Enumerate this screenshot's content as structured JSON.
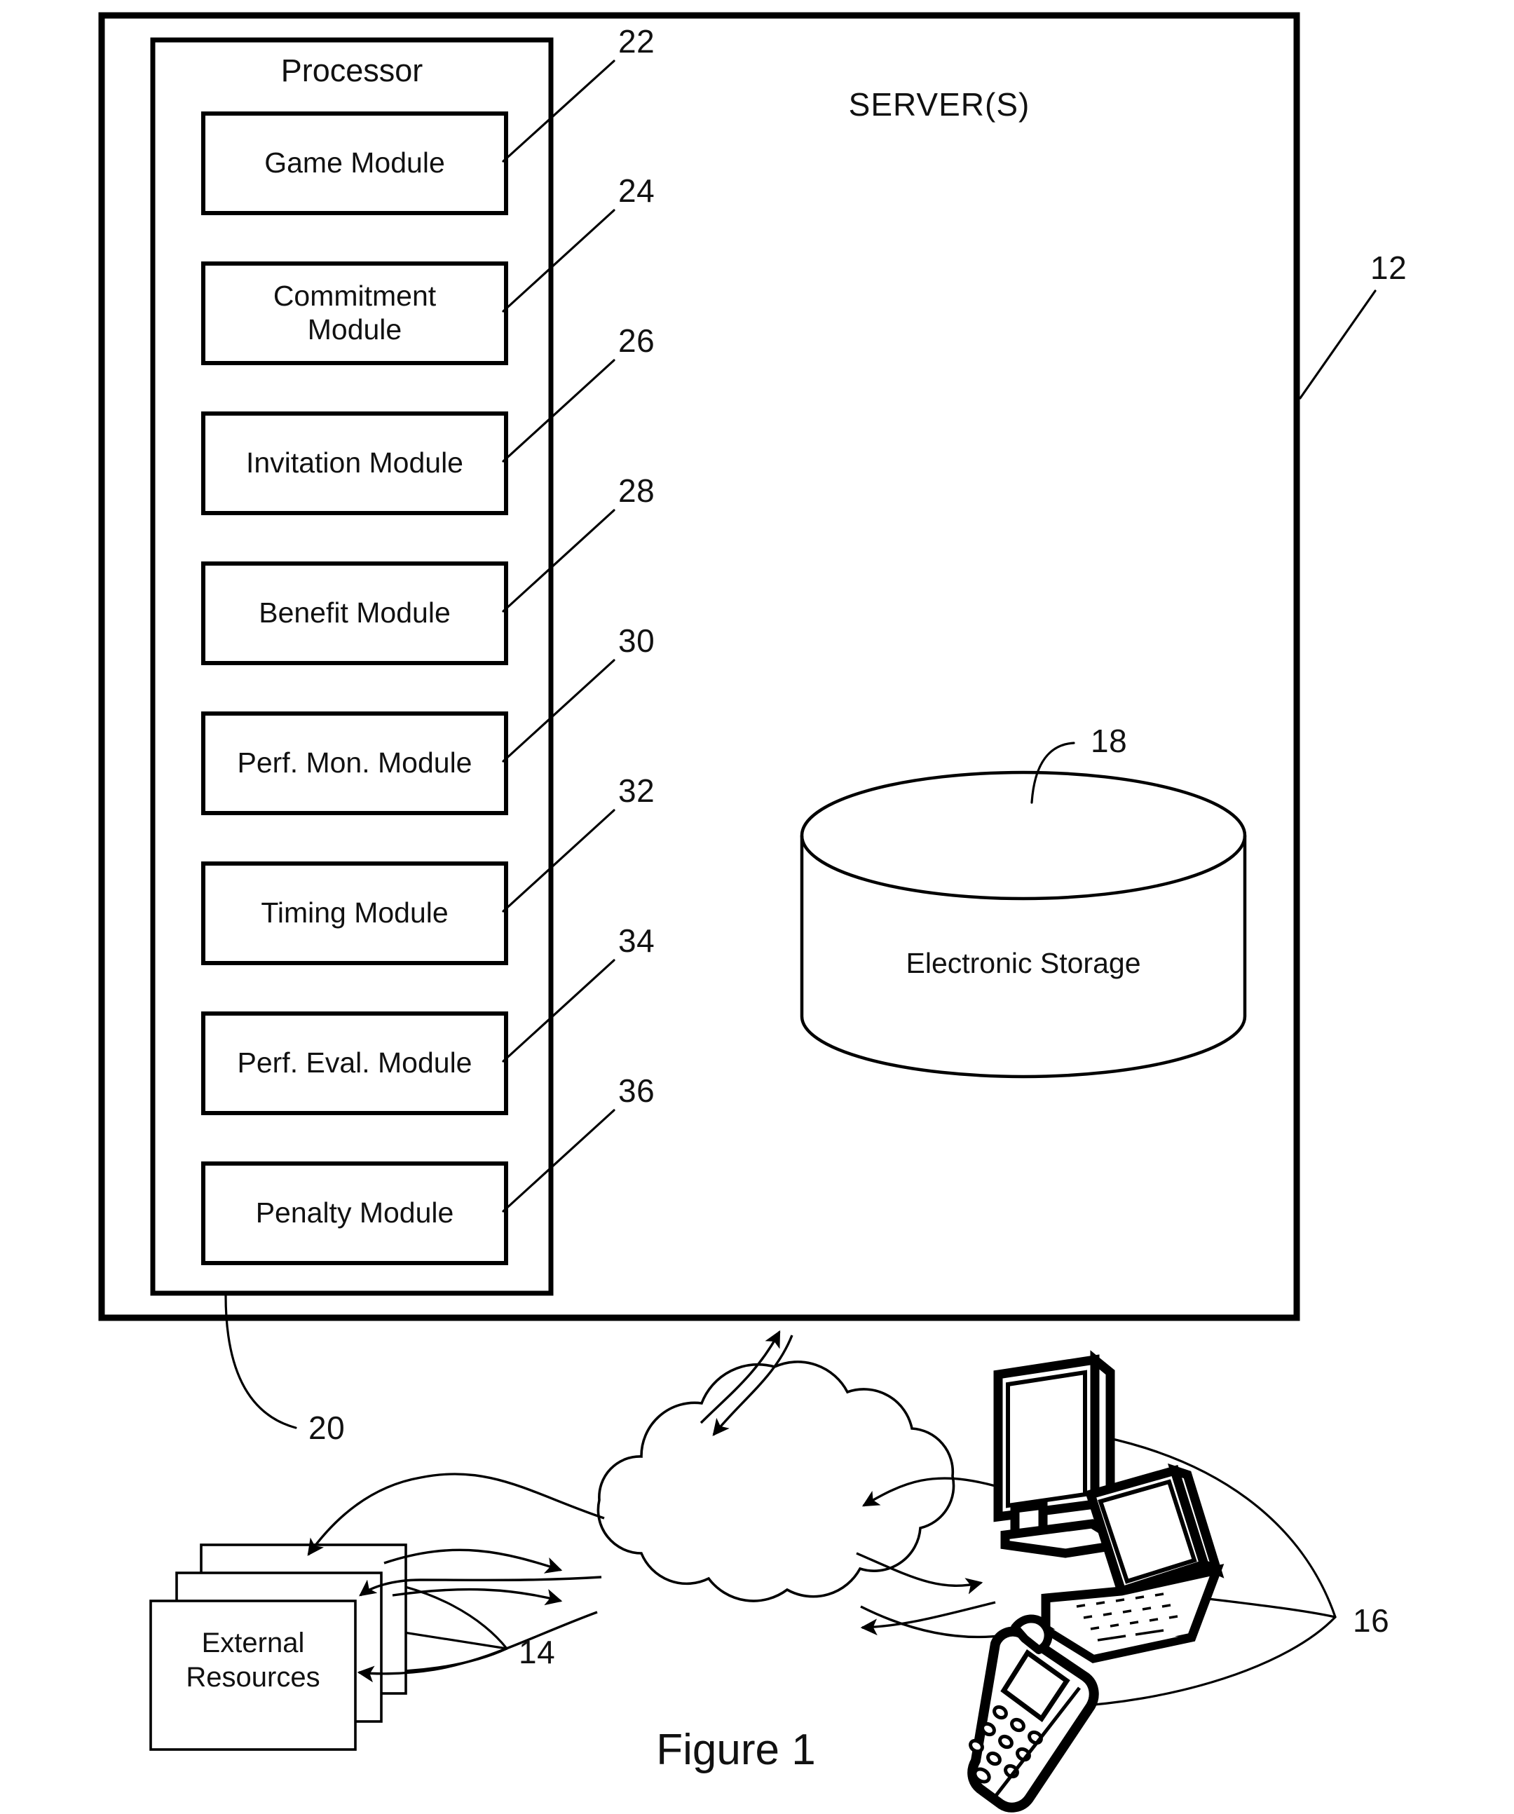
{
  "figure": {
    "caption": "Figure 1",
    "title_block": "SERVER(S)"
  },
  "server_box": {
    "label": "SERVER(S)",
    "ref": "12"
  },
  "processor": {
    "label": "Processor",
    "ref": "20",
    "modules": [
      {
        "label": "Game Module",
        "ref": "22"
      },
      {
        "label": "Commitment\nModule",
        "ref": "24"
      },
      {
        "label": "Invitation Module",
        "ref": "26"
      },
      {
        "label": "Benefit Module",
        "ref": "28"
      },
      {
        "label": "Perf. Mon. Module",
        "ref": "30"
      },
      {
        "label": "Timing Module",
        "ref": "32"
      },
      {
        "label": "Perf. Eval. Module",
        "ref": "34"
      },
      {
        "label": "Penalty Module",
        "ref": "36"
      }
    ]
  },
  "storage": {
    "label": "Electronic Storage",
    "ref": "18"
  },
  "external_resources": {
    "label": "External\nResources",
    "ref": "14"
  },
  "network": {
    "label": "",
    "icon": "cloud-icon"
  },
  "client_devices": {
    "ref": "16",
    "items": [
      {
        "icon": "desktop-monitor-icon"
      },
      {
        "icon": "laptop-icon"
      },
      {
        "icon": "mobile-phone-icon"
      }
    ]
  },
  "colors": {
    "ink": "#000000",
    "paper": "#ffffff"
  }
}
